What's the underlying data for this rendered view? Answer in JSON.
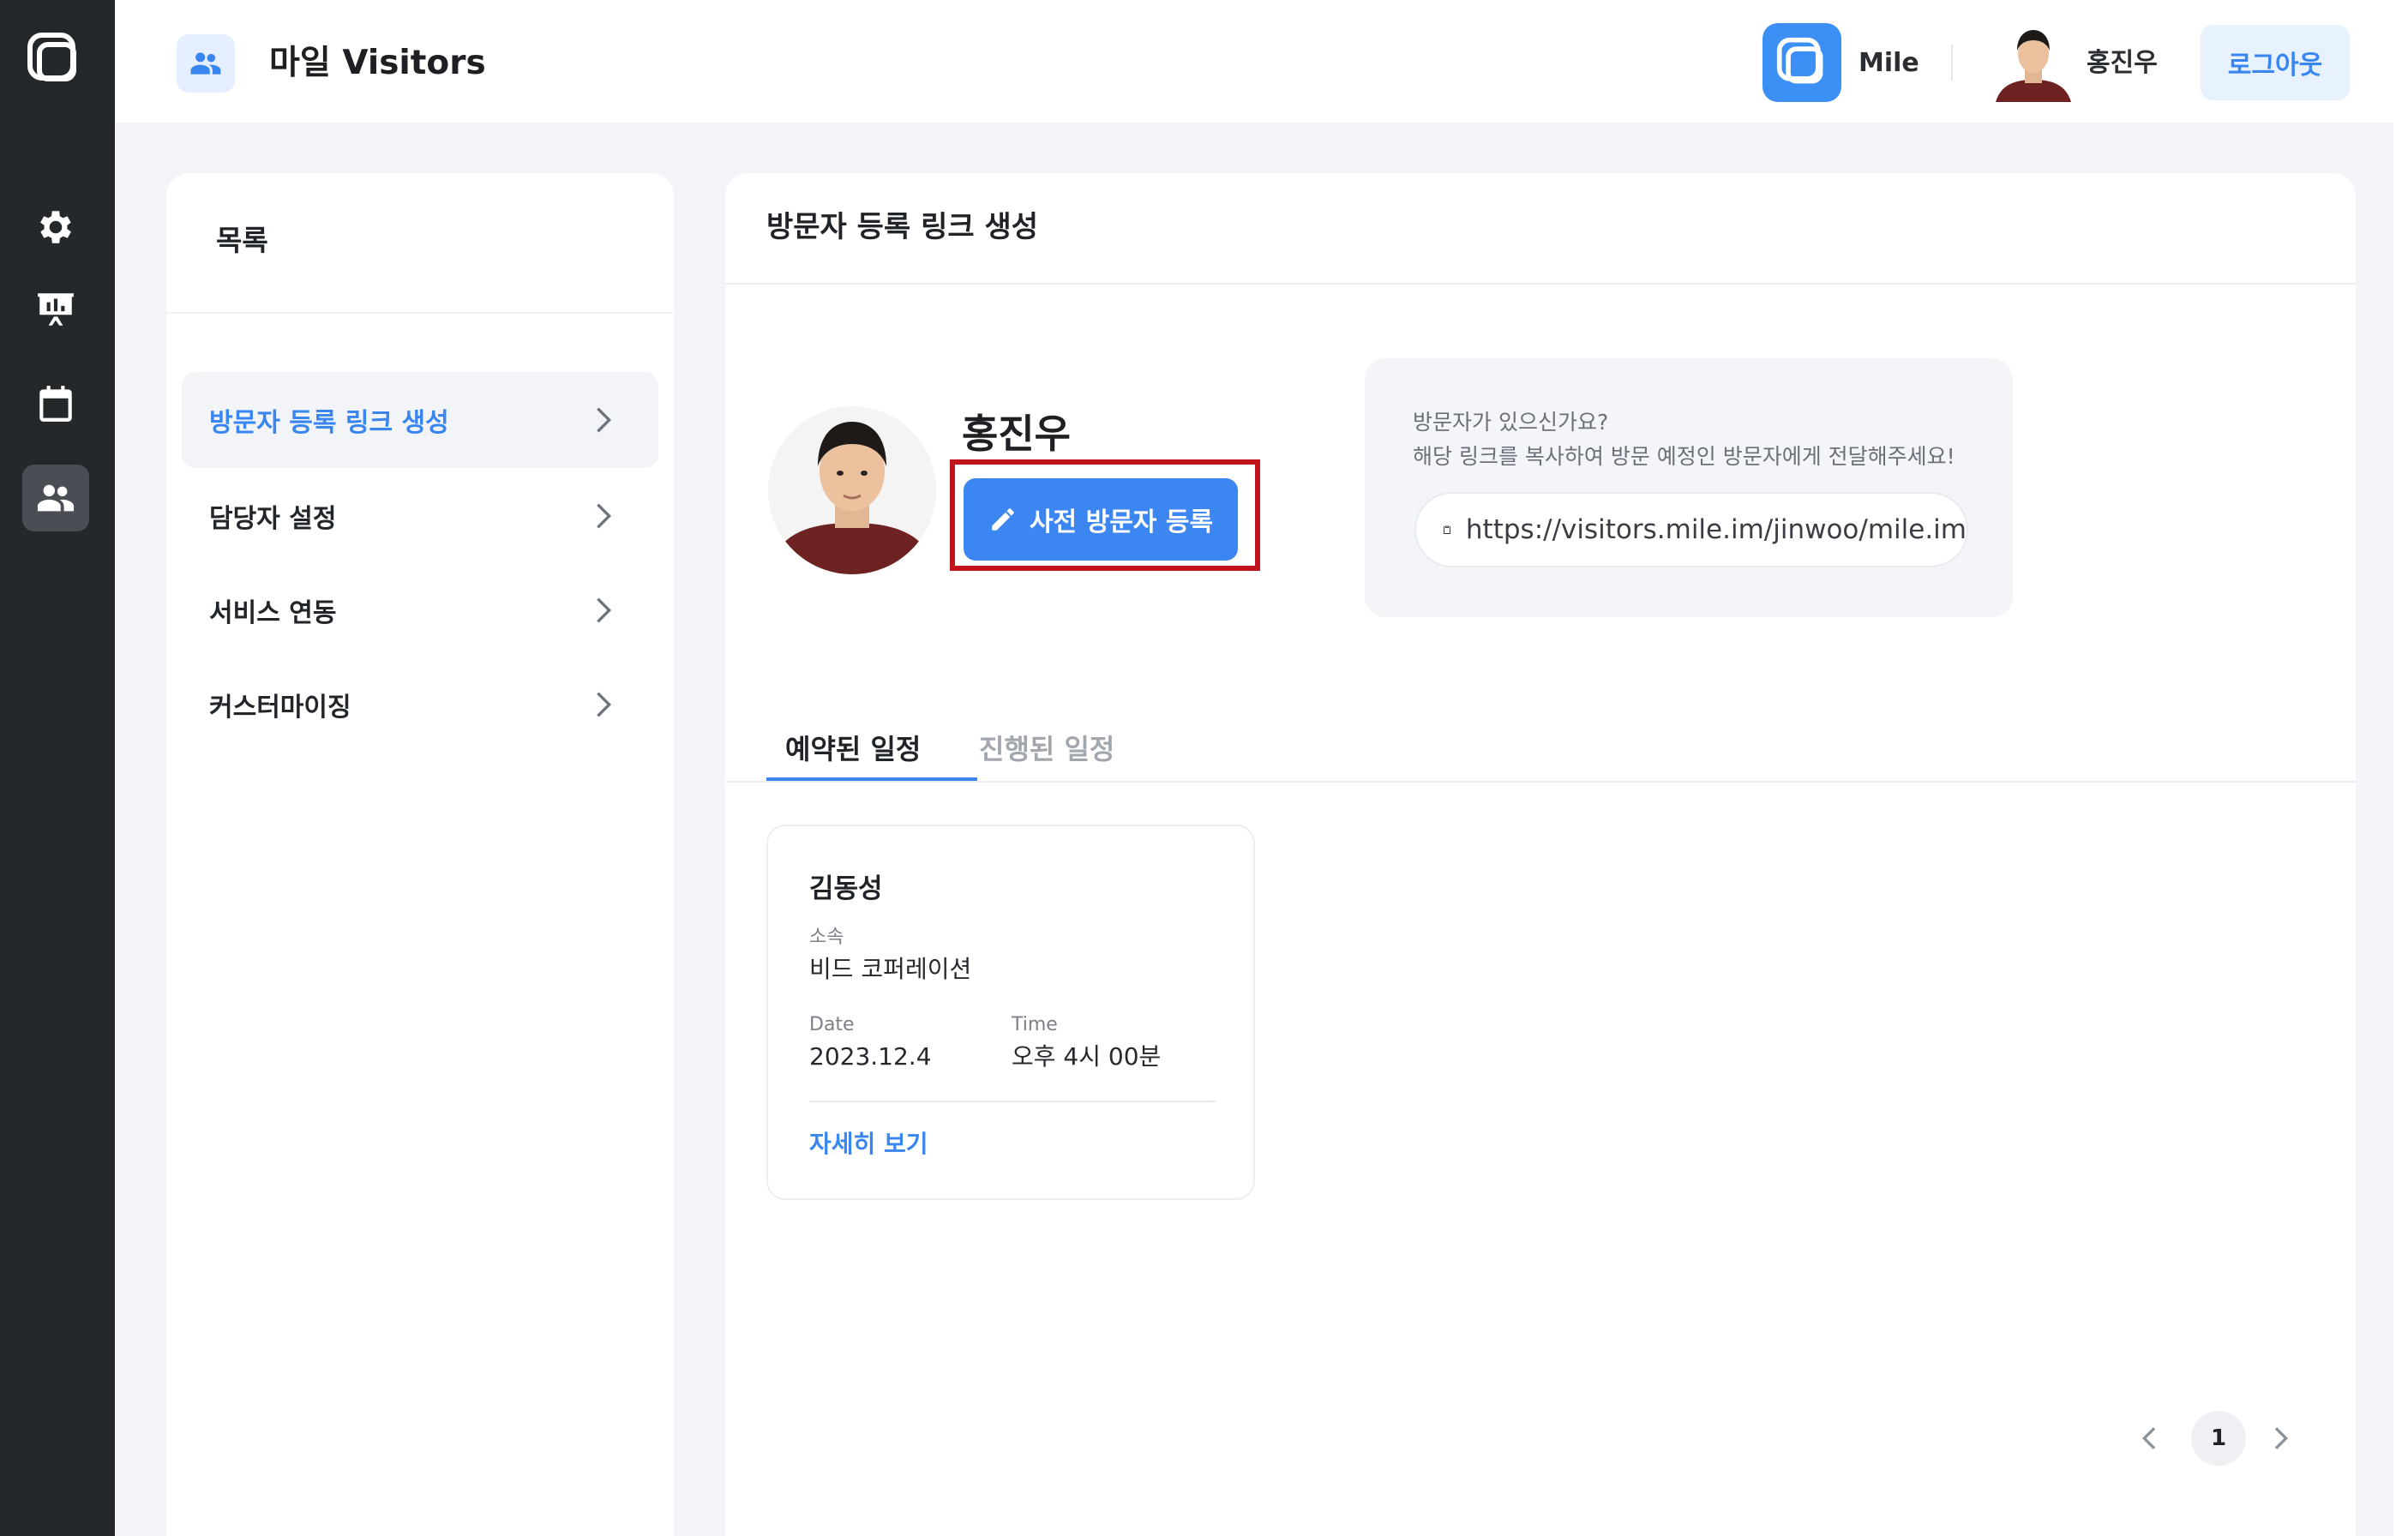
{
  "header": {
    "title": "마일 Visitors",
    "brand_name": "Mile",
    "user_name": "홍진우",
    "logout_label": "로그아웃"
  },
  "rail": {
    "items": [
      "logo-icon",
      "settings-icon",
      "presentation-icon",
      "calendar-icon",
      "people-icon"
    ],
    "active": "people-icon"
  },
  "sidebar": {
    "title": "목록",
    "items": [
      {
        "label": "방문자 등록 링크 생성",
        "active": true
      },
      {
        "label": "담당자 설정",
        "active": false
      },
      {
        "label": "서비스 연동",
        "active": false
      },
      {
        "label": "커스터마이징",
        "active": false
      }
    ]
  },
  "main": {
    "title": "방문자 등록 링크 생성",
    "profile_name": "홍진우",
    "preregister_label": "사전 방문자 등록",
    "link_card": {
      "question": "방문자가 있으신가요?",
      "instruction": "해당 링크를 복사하여 방문 예정인 방문자에게 전달해주세요!",
      "url": "https://visitors.mile.im/jinwoo/mile.im"
    },
    "tabs": [
      {
        "label": "예약된 일정",
        "active": true
      },
      {
        "label": "진행된 일정",
        "active": false
      }
    ],
    "visit": {
      "name": "김동성",
      "affiliation_label": "소속",
      "affiliation": "비드 코퍼레이션",
      "date_label": "Date",
      "date": "2023.12.4",
      "time_label": "Time",
      "time": "오후 4시 00분",
      "detail_link": "자세히 보기"
    },
    "pagination": {
      "current": "1"
    }
  },
  "colors": {
    "accent": "#3a86f0",
    "rail_bg": "#25282b",
    "highlight": "#c0131c"
  }
}
